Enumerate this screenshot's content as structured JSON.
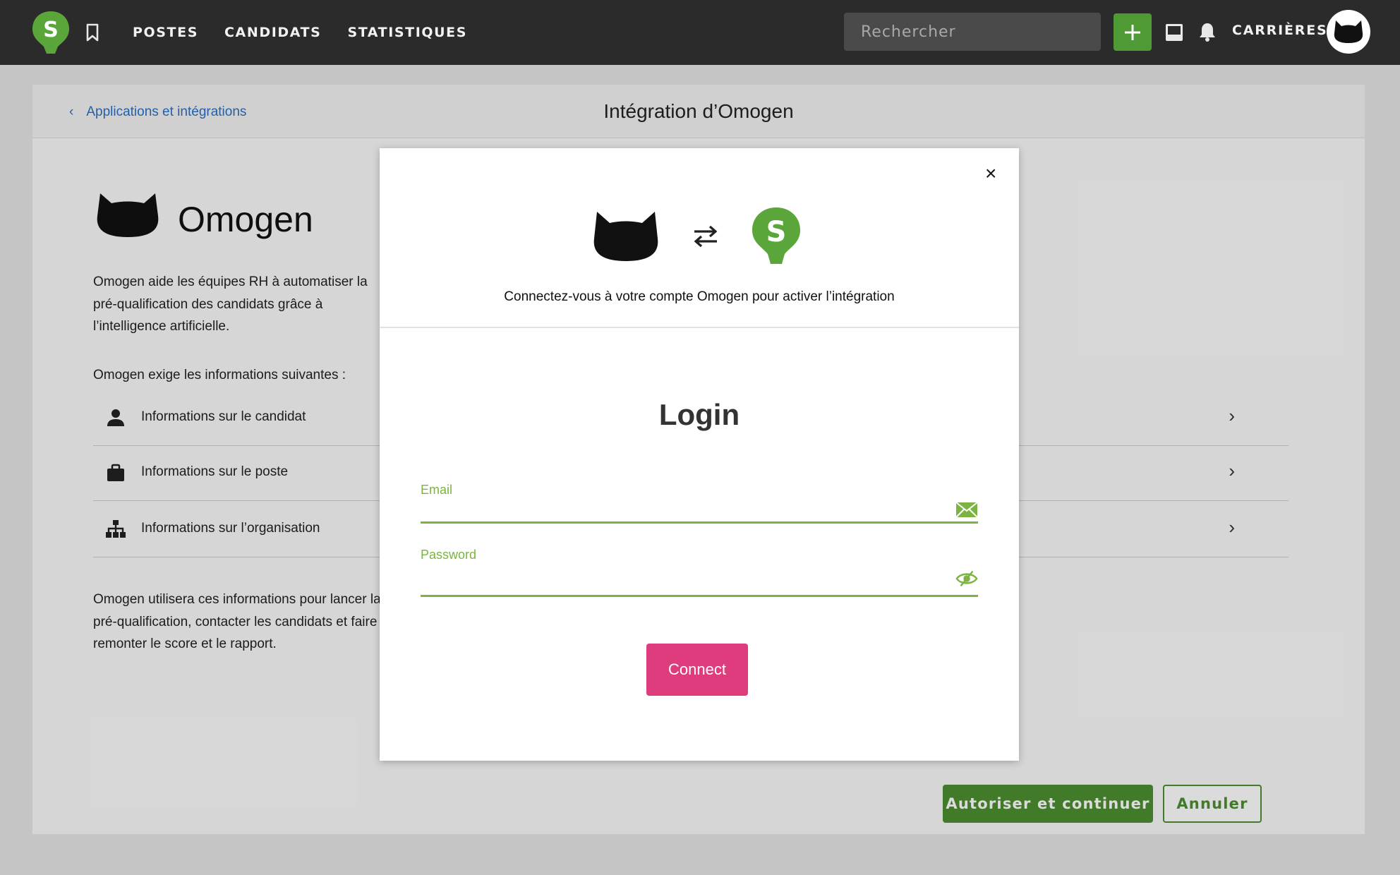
{
  "topbar": {
    "brand_letter": "S",
    "nav": [
      "POSTES",
      "CANDIDATS",
      "STATISTIQUES"
    ],
    "search_placeholder": "Rechercher",
    "careers_label": "CARRIÈRES",
    "icons": [
      "bookmark-icon",
      "plus-icon",
      "inbox-icon",
      "bell-icon",
      "cat-avatar-icon"
    ]
  },
  "page": {
    "back_label": "Applications et intégrations",
    "title": "Intégration d’Omogen",
    "app_name": "Omogen",
    "description": "Omogen aide les équipes RH à automatiser la pré-qualification des candidats grâce à l’intelligence artificielle.",
    "requirements_intro": "Omogen exige les informations suivantes :",
    "requirements": [
      {
        "label": "Informations sur le candidat",
        "icon": "person-icon"
      },
      {
        "label": "Informations sur le poste",
        "icon": "briefcase-icon"
      },
      {
        "label": "Informations sur l’organisation",
        "icon": "org-chart-icon"
      }
    ],
    "usage_note": "Omogen utilisera ces informations pour lancer la pré-qualification, contacter les candidats et faire remonter le score et le rapport.",
    "authorize_label": "Autoriser et continuer",
    "cancel_label": "Annuler"
  },
  "modal": {
    "close_label": "×",
    "subtitle": "Connectez-vous à votre compte Omogen pour activer l’intégration",
    "login_title": "Login",
    "email_label": "Email",
    "email_value": "",
    "password_label": "Password",
    "password_value": "",
    "connect_label": "Connect"
  },
  "colors": {
    "topbar": "#2b2b2b",
    "brand_green": "#4f9a34",
    "field_green": "#7cb342",
    "connect_pink": "#de3c7c",
    "link_blue": "#2a6fc4"
  }
}
